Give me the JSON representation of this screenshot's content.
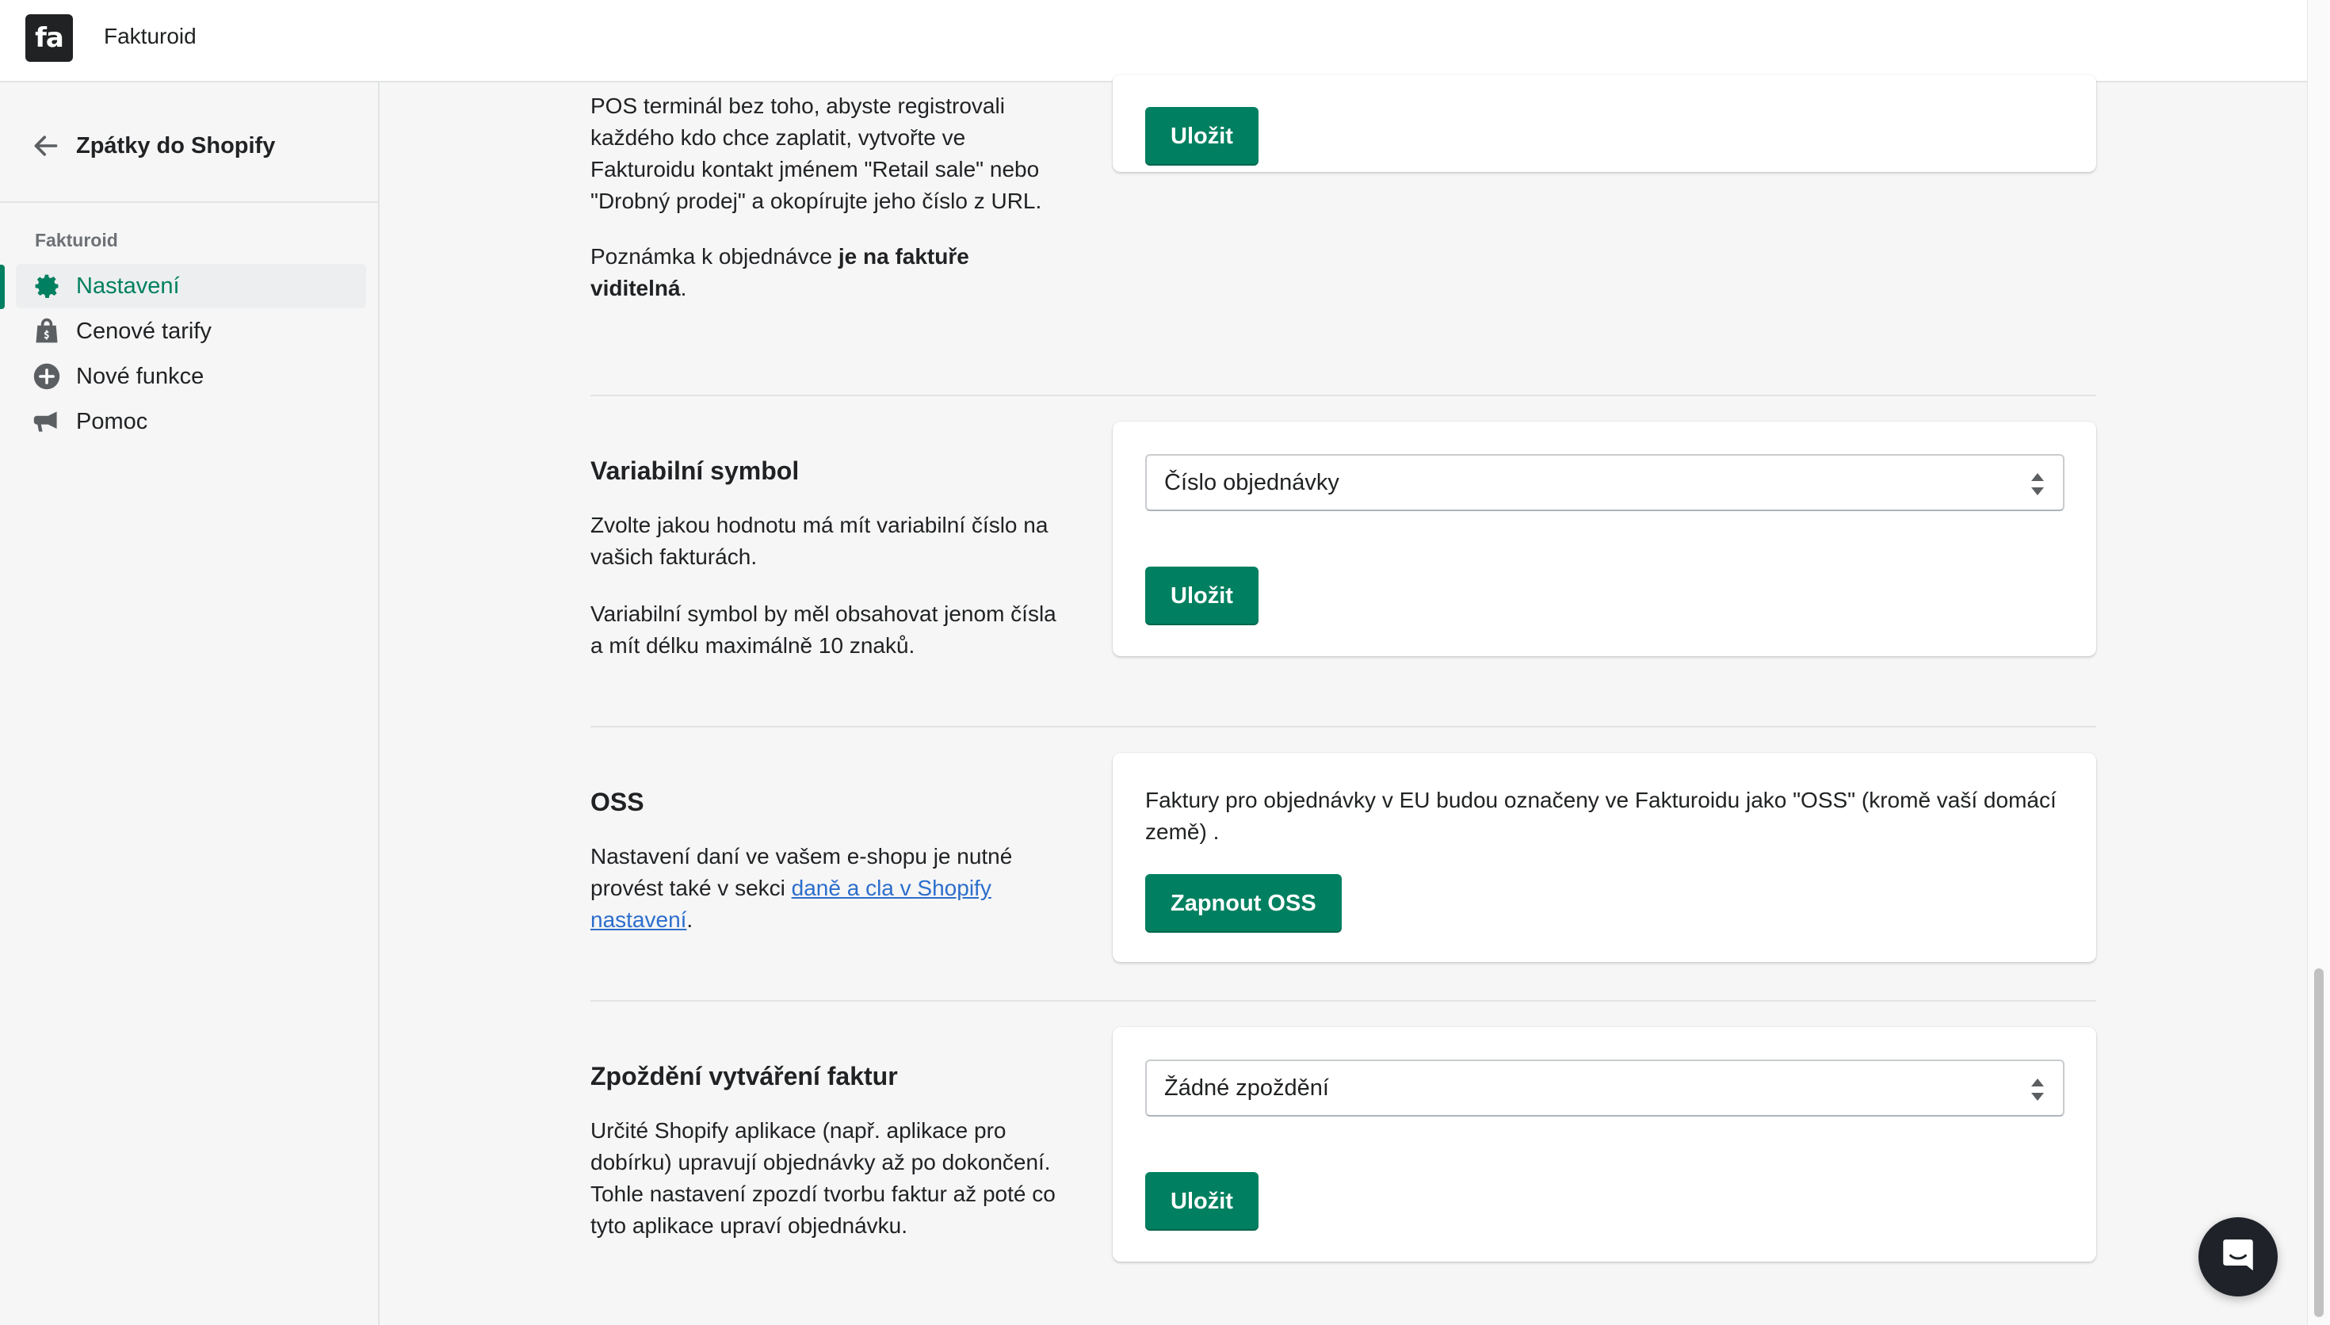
{
  "header": {
    "logo_text": "fa",
    "app_name": "Fakturoid"
  },
  "sidebar": {
    "back_label": "Zpátky do Shopify",
    "section_title": "Fakturoid",
    "items": [
      {
        "label": "Nastavení",
        "icon": "gear-icon",
        "active": true
      },
      {
        "label": "Cenové tarify",
        "icon": "shopping-bag-icon",
        "active": false
      },
      {
        "label": "Nové funkce",
        "icon": "plus-circle-icon",
        "active": false
      },
      {
        "label": "Pomoc",
        "icon": "megaphone-icon",
        "active": false
      }
    ]
  },
  "sections": {
    "retail": {
      "text1": "POS terminál bez toho, abyste registrovali každého kdo chce zaplatit, vytvořte ve Fakturoidu kontakt jménem \"Retail sale\" nebo \"Drobný prodej\" a okopírujte jeho číslo z URL.",
      "note_prefix": "Poznámka k objednávce ",
      "note_bold": "je na faktuře viditelná",
      "note_suffix": ".",
      "save_label": "Uložit"
    },
    "variable_symbol": {
      "title": "Variabilní symbol",
      "text1": "Zvolte jakou hodnotu má mít variabilní číslo na vašich fakturách.",
      "text2": "Variabilní symbol by měl obsahovat jenom čísla a mít délku maximálně 10 znaků.",
      "select_value": "Číslo objednávky",
      "save_label": "Uložit"
    },
    "oss": {
      "title": "OSS",
      "text_prefix": "Nastavení daní ve vašem e-shopu je nutné provést také v sekci ",
      "link_text": "daně a cla v Shopify nastavení",
      "text_suffix": ".",
      "card_text": "Faktury pro objednávky v EU budou označeny ve Fakturoidu jako \"OSS\" (kromě vaší domácí země) .",
      "button_label": "Zapnout OSS"
    },
    "delay": {
      "title": "Zpoždění vytváření faktur",
      "text": "Určité Shopify aplikace (např. aplikace pro dobírku) upravují objednávky až po dokončení. Tohle nastavení zpozdí tvorbu faktur až poté co tyto aplikace upraví objednávku.",
      "select_value": "Žádné zpoždění",
      "save_label": "Uložit"
    }
  },
  "colors": {
    "primary": "#008060",
    "link": "#2c6ecb",
    "text": "#202223"
  }
}
